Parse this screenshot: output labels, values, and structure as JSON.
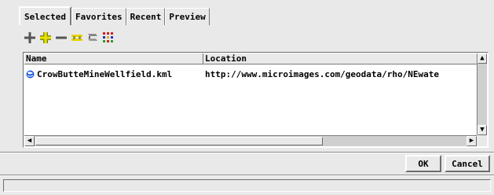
{
  "tabs": [
    {
      "label": "Selected",
      "active": true
    },
    {
      "label": "Favorites",
      "active": false
    },
    {
      "label": "Recent",
      "active": false
    },
    {
      "label": "Preview",
      "active": false
    }
  ],
  "toolbar": {
    "icons": [
      "add-icon",
      "add-multiple-icon",
      "remove-icon",
      "remove-multiple-icon",
      "link-icon",
      "grid-icon"
    ]
  },
  "list": {
    "columns": [
      "Name",
      "Location"
    ],
    "rows": [
      {
        "name": "CrowButteMineWellfield.kml",
        "location": "http://www.microimages.com/geodata/rho/NEwate"
      }
    ]
  },
  "buttons": {
    "ok": "OK",
    "cancel": "Cancel"
  },
  "status": {
    "text": ""
  }
}
